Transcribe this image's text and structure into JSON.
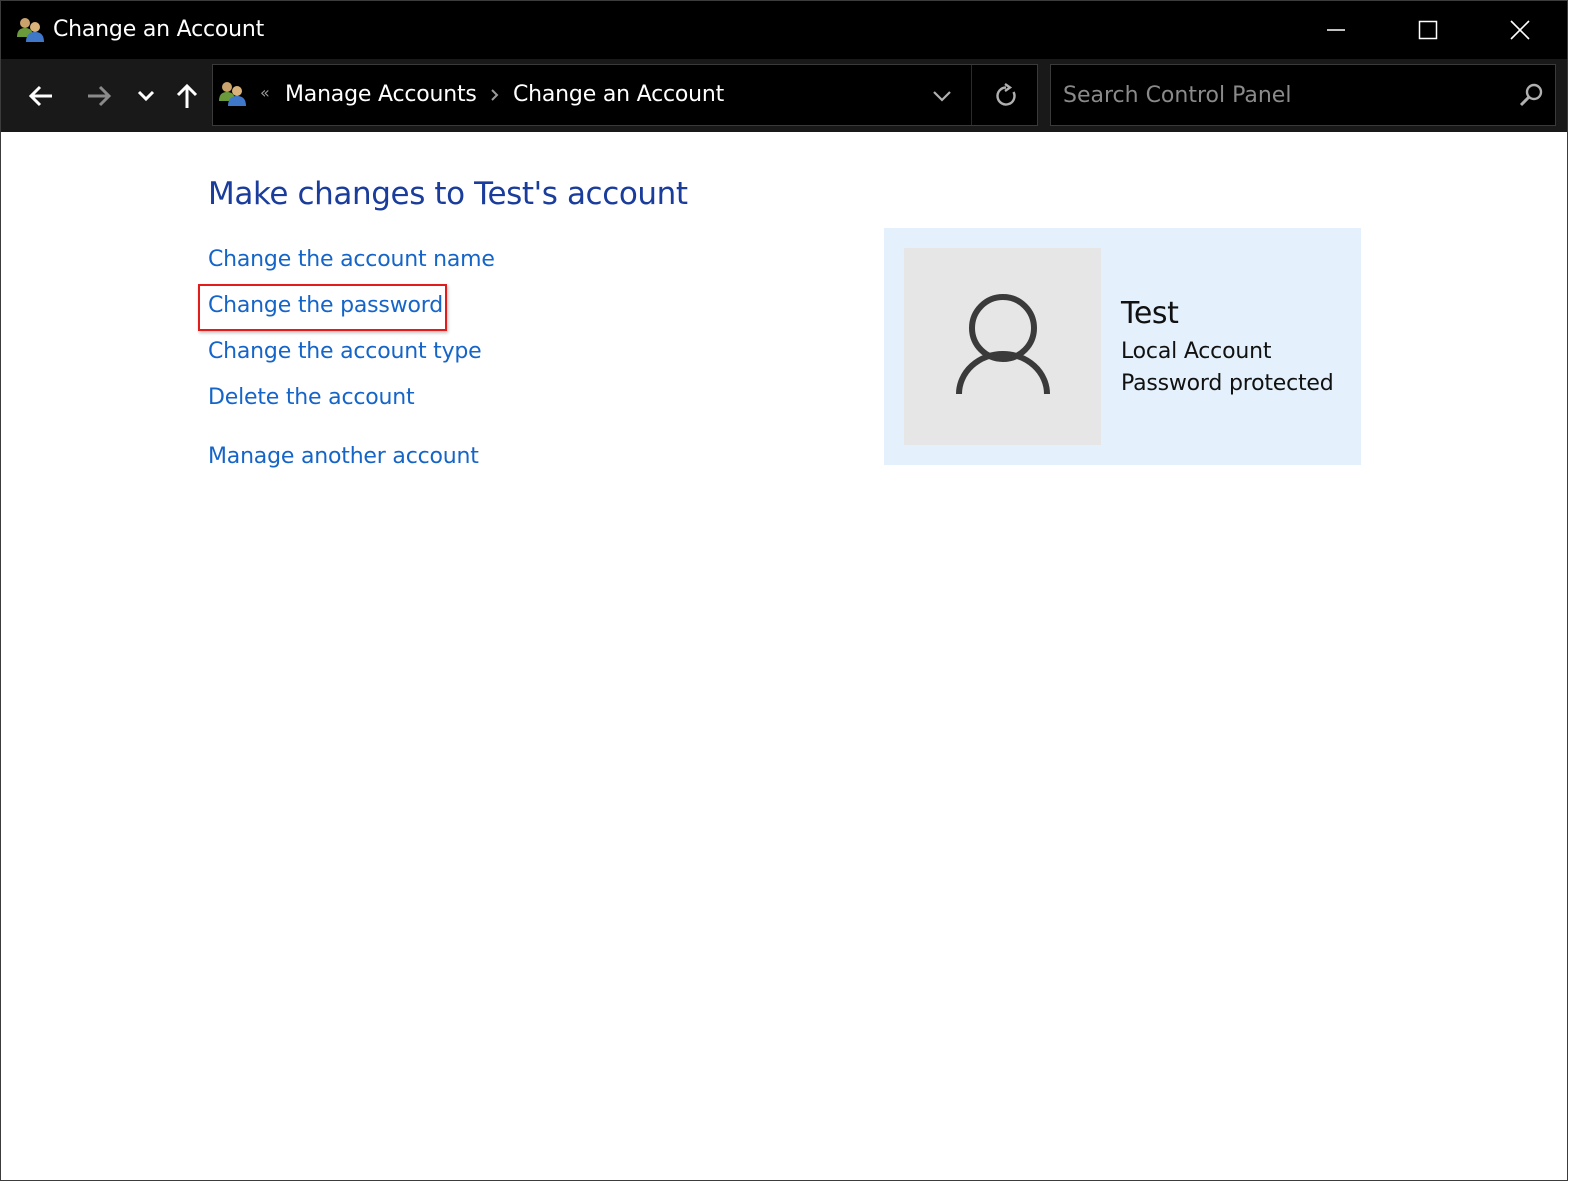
{
  "window": {
    "title": "Change an Account",
    "controls": {
      "minimize": "minimize-icon",
      "maximize": "maximize-icon",
      "close": "close-icon"
    }
  },
  "nav": {
    "back_icon": "arrow-left-icon",
    "forward_icon": "arrow-right-icon",
    "recent_icon": "chevron-down-icon",
    "up_icon": "arrow-up-icon"
  },
  "address": {
    "overflow": "«",
    "crumbs": [
      "Manage Accounts",
      "Change an Account"
    ]
  },
  "search": {
    "placeholder": "Search Control Panel",
    "value": ""
  },
  "main": {
    "title": "Make changes to Test's account",
    "links": [
      "Change the account name",
      "Change the password",
      "Change the account type",
      "Delete the account",
      "Manage another account"
    ]
  },
  "account": {
    "name": "Test",
    "type": "Local Account",
    "status": "Password protected"
  },
  "colors": {
    "title_blue": "#1a3d9c",
    "link_blue": "#1565c8",
    "highlight_red": "#e21b1b",
    "card_bg": "#e4f1fc",
    "avatar_bg": "#e6e6e6"
  }
}
